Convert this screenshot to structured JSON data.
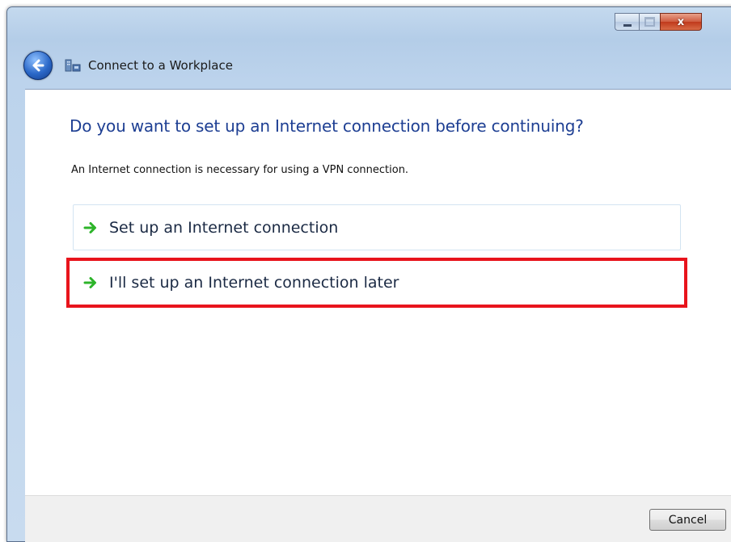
{
  "window": {
    "title": "Connect to a Workplace",
    "close_glyph": "x"
  },
  "icons": {
    "back": "back-arrow-icon",
    "app": "workplace-network-icon",
    "option_arrow": "green-arrow-icon"
  },
  "main": {
    "heading": "Do you want to set up an Internet connection before continuing?",
    "description": "An Internet connection is necessary for using a VPN connection.",
    "options": [
      {
        "label": "Set up an Internet connection"
      },
      {
        "label": "I'll set up an Internet connection later",
        "highlighted": true
      }
    ]
  },
  "footer": {
    "cancel_label": "Cancel"
  },
  "colors": {
    "heading": "#1e3f93",
    "highlight_border": "#e8141c",
    "arrow": "#2db42a"
  }
}
